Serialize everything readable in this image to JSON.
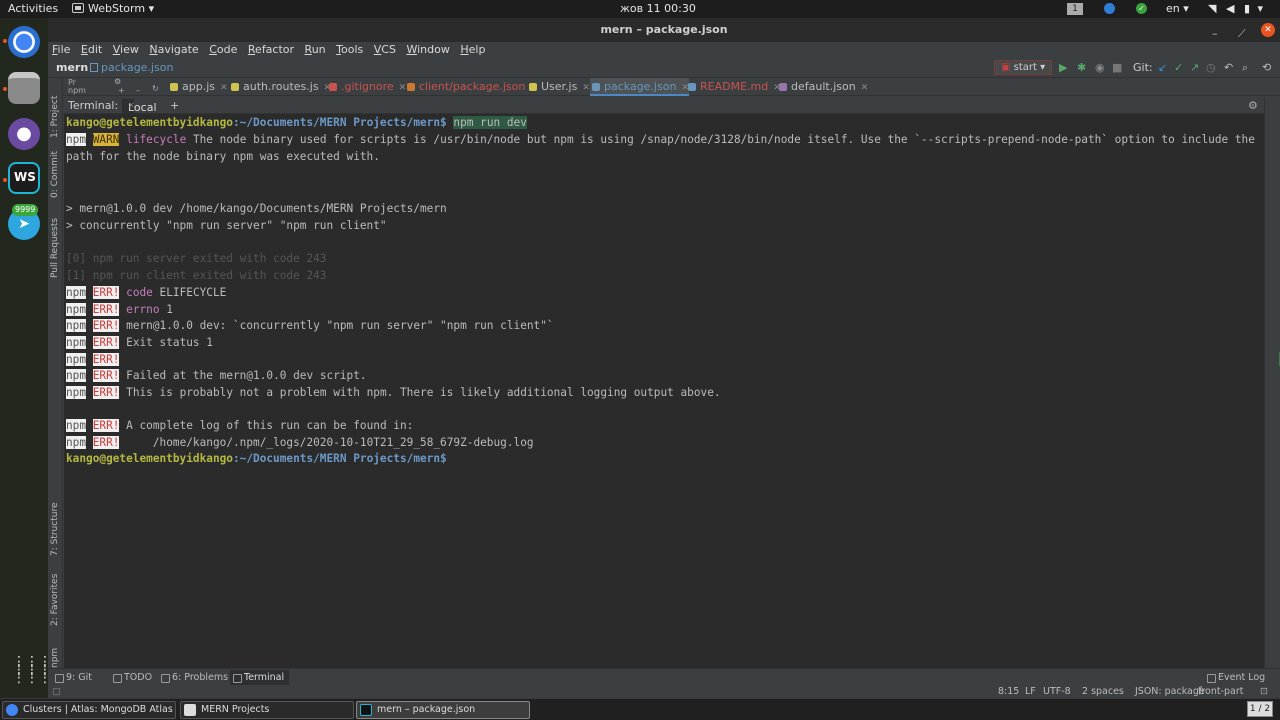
{
  "topbar": {
    "activities": "Activities",
    "app_name": "WebStorm",
    "app_arrow": "▾",
    "clock": "жов 11  00:30",
    "workspace_num": "1",
    "lang": "en ▾",
    "status_arrow": "▾"
  },
  "dock": {
    "badge_count": "9999",
    "grid_icon": "⋮⋮⋮"
  },
  "window": {
    "title": "mern – package.json",
    "minimize": "–",
    "restore": "⟋",
    "close": "✕"
  },
  "menu": [
    "File",
    "Edit",
    "View",
    "Navigate",
    "Code",
    "Refactor",
    "Run",
    "Tools",
    "VCS",
    "Window",
    "Help"
  ],
  "navbar": {
    "project": "mern",
    "file": "package.json",
    "run_config": "start ▾",
    "git_label": "Git:"
  },
  "project_tool": {
    "label": "Pr",
    "sub": "npm",
    "add_icon": "+",
    "minus_icon": "–"
  },
  "tabs": [
    {
      "label": "app.js",
      "close": "✕"
    },
    {
      "label": "auth.routes.js",
      "close": "✕"
    },
    {
      "label": ".gitignore",
      "close": "✕"
    },
    {
      "label": "client/package.json",
      "close": "✕"
    },
    {
      "label": "User.js",
      "close": "✕"
    },
    {
      "label": "package.json",
      "close": "✕"
    },
    {
      "label": "README.md",
      "close": "✕"
    },
    {
      "label": "default.json",
      "close": "✕"
    }
  ],
  "left_tools": [
    "1: Project",
    "0: Commit",
    "Pull Requests",
    "7: Structure",
    "2: Favorites",
    "npm"
  ],
  "terminal_head": {
    "label": "Terminal:",
    "tab": "Local",
    "add": "+",
    "gear": "⚙",
    "hide": "–"
  },
  "terminal": {
    "prompt_user": "kango@getelementbyidkango",
    "prompt_path": ":~/Documents/MERN Projects/mern",
    "prompt_sign": "$",
    "command": "npm run dev",
    "npm": "npm",
    "warn": "WARN",
    "err": "ERR!",
    "warn_kw": "lifecycle",
    "warn_text": "The node binary used for scripts is /usr/bin/node but npm is using /snap/node/3128/bin/node itself. Use the `--scripts-prepend-node-path` option to include the path for the node binary npm was executed with.",
    "info1": "> mern@1.0.0 dev /home/kango/Documents/MERN Projects/mern",
    "info2": "> concurrently \"npm run server\" \"npm run client\"",
    "exit0": "[0] npm run server exited with code 243",
    "exit1": "[1] npm run client exited with code 243",
    "err_lines": [
      {
        "kw": "code",
        "text": "ELIFECYCLE"
      },
      {
        "kw": "errno",
        "text": "1"
      },
      {
        "kw": "",
        "text": "mern@1.0.0 dev: `concurrently \"npm run server\" \"npm run client\"`"
      },
      {
        "kw": "",
        "text": "Exit status 1"
      },
      {
        "kw": "",
        "text": ""
      },
      {
        "kw": "",
        "text": "Failed at the mern@1.0.0 dev script."
      },
      {
        "kw": "",
        "text": "This is probably not a problem with npm. There is likely additional logging output above."
      }
    ],
    "log_lines": [
      "A complete log of this run can be found in:",
      "    /home/kango/.npm/_logs/2020-10-10T21_29_58_679Z-debug.log"
    ]
  },
  "bottom_tools": [
    "9: Git",
    "TODO",
    "6: Problems",
    "Terminal"
  ],
  "event_log": "Event Log",
  "status": {
    "position": "8:15",
    "line_sep": "LF",
    "encoding": "UTF-8",
    "indent": "2 spaces",
    "schema": "JSON: package",
    "branch": "front-part"
  },
  "taskbar": {
    "tasks": [
      "Clusters | Atlas: MongoDB Atlas - ...",
      "MERN Projects",
      "mern – package.json"
    ],
    "pager": "1 / 2"
  },
  "colors": {
    "accent": "#4a88c7",
    "prompt_user": "#b4b841",
    "prompt_path": "#6c99c7",
    "err": "#cc3e3e",
    "warn_bg": "#d9b43b",
    "ubuntu_orange": "#e95420"
  }
}
